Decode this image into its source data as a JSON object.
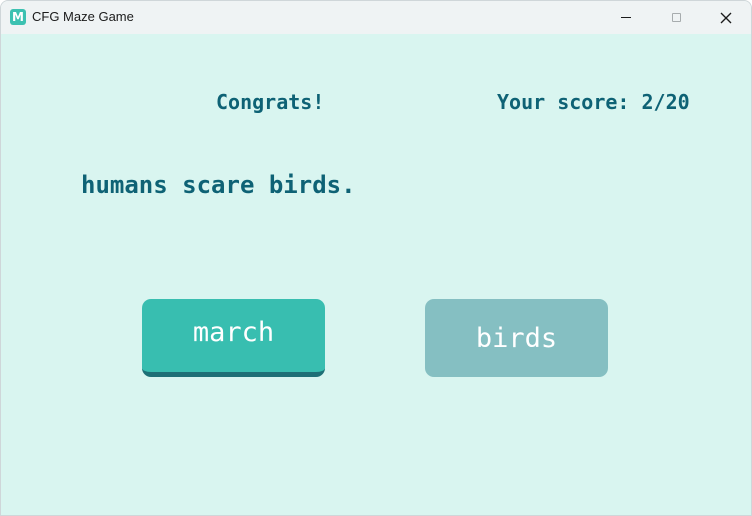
{
  "window": {
    "title": "CFG Maze Game",
    "icon": "maze-app-icon",
    "icon_glyph": "M",
    "controls": [
      "minimize",
      "maximize",
      "close"
    ],
    "close_glyph": "✕"
  },
  "game": {
    "congrats": "Congrats!",
    "score": "Your score: 2/20",
    "phrase": "humans scare birds.",
    "answers": [
      {
        "label": "march",
        "state": "hovered",
        "color": "#38beb0"
      },
      {
        "label": "birds",
        "state": "normal",
        "color": "#85bfc2"
      }
    ]
  },
  "colors": {
    "background": "#d9f5f0",
    "text": "#0e6275"
  }
}
